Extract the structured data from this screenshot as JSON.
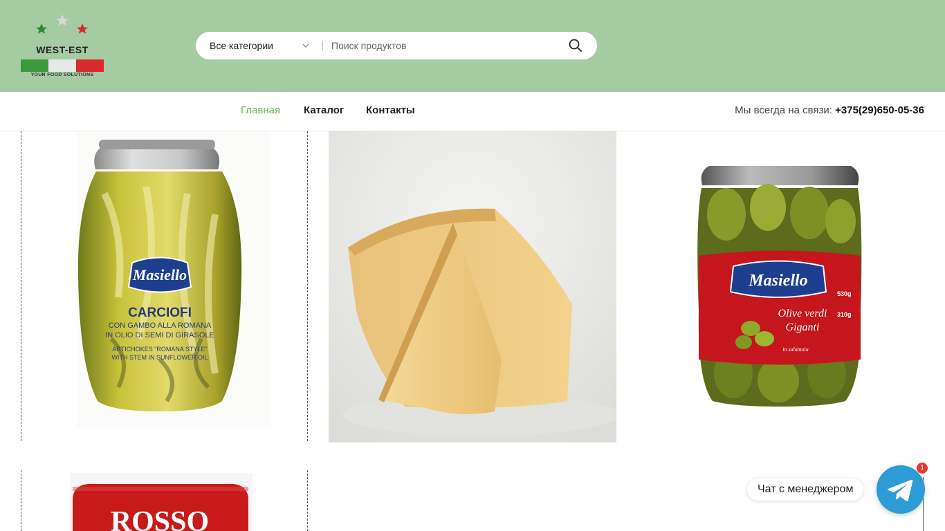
{
  "header": {
    "logo": {
      "name": "WEST-EST",
      "tagline": "YOUR FOOD SOLUTIONS",
      "flag_colors": [
        "#3a9a3c",
        "#e8e8e8",
        "#d72b2b"
      ]
    },
    "search": {
      "category_selected": "Все категории",
      "placeholder": "Поиск продуктов",
      "icon": "search-icon"
    }
  },
  "nav": {
    "items": [
      {
        "label": "Главная",
        "active": true
      },
      {
        "label": "Каталог",
        "active": false
      },
      {
        "label": "Контакты",
        "active": false
      }
    ],
    "contact_prefix": "Мы всегда на связи:",
    "contact_phone": "+375(29)650-05-36"
  },
  "products": [
    {
      "brand": "Masiello",
      "name": "CARCIOFI",
      "subtitle": "CON GAMBO ALLA ROMANA IN OLIO DI SEMI DI GIRASOLE",
      "english": "ARTICHOKES \"ROMANA STYLE\" WITH STEM IN SUNFLOWER OIL"
    },
    {
      "name": "Parmigiano cheese"
    },
    {
      "brand": "Masiello",
      "name": "Olive verdi Giganti",
      "weight": "530g",
      "drained": "310g",
      "note": "in salamoia"
    },
    {
      "brand": "ROSSO"
    }
  ],
  "chat": {
    "label": "Чат с менеджером",
    "badge": "1",
    "icon": "telegram-icon"
  },
  "colors": {
    "header_bg": "#a5cba3",
    "accent": "#6cb64b",
    "chat_blue": "#2d9bd6"
  }
}
